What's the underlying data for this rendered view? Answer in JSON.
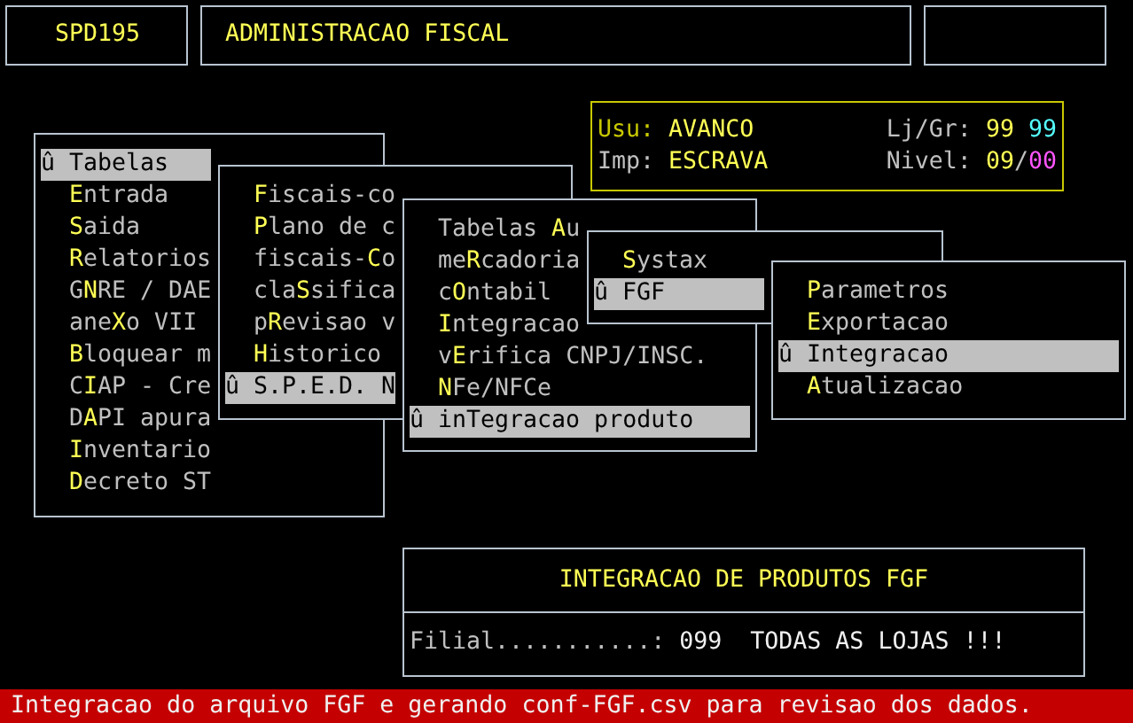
{
  "header": {
    "program_code": "SPD195",
    "title": "ADMINISTRACAO FISCAL"
  },
  "session": {
    "user_label": "Usu:",
    "user": "AVANCO",
    "store_label": "Lj/Gr:",
    "store": "99",
    "group": "99",
    "printer_label": "Imp:",
    "printer": "ESCRAVA",
    "level_label": "Nivel:",
    "level_user": "09",
    "level_sep": "/",
    "level_group": "00"
  },
  "menus": [
    {
      "items": [
        {
          "marker": "û",
          "label": "Tabelas",
          "selected": true
        },
        {
          "hotkey": "E",
          "after": "ntrada",
          "selected": false
        },
        {
          "hotkey": "S",
          "after": "aida",
          "selected": false
        },
        {
          "hotkey": "R",
          "after": "elatorios",
          "selected": false
        },
        {
          "before": "G",
          "hotkey": "N",
          "after": "RE / DAE",
          "selected": false
        },
        {
          "before": "ane",
          "hotkey": "X",
          "after": "o VII",
          "selected": false
        },
        {
          "hotkey": "B",
          "after": "loquear m",
          "selected": false
        },
        {
          "before": "C",
          "hotkey": "I",
          "after": "AP - Cre",
          "selected": false
        },
        {
          "before": "D",
          "hotkey": "A",
          "after": "PI apura",
          "selected": false
        },
        {
          "hotkey": "I",
          "after": "nventario",
          "selected": false
        },
        {
          "hotkey": "D",
          "after": "ecreto ST",
          "selected": false
        }
      ]
    },
    {
      "items": [
        {
          "hotkey": "F",
          "after": "iscais-co",
          "selected": false
        },
        {
          "hotkey": "P",
          "after": "lano de c",
          "selected": false
        },
        {
          "before": "fiscais-",
          "hotkey": "C",
          "after": "o",
          "selected": false
        },
        {
          "before": "cla",
          "hotkey": "S",
          "after": "sifica",
          "selected": false
        },
        {
          "before": "p",
          "hotkey": "R",
          "after": "evisao v",
          "selected": false
        },
        {
          "hotkey": "H",
          "after": "istorico",
          "selected": false
        },
        {
          "marker": "û",
          "label": "S.P.E.D. N",
          "selected": true
        }
      ]
    },
    {
      "items": [
        {
          "before": "Tabelas ",
          "hotkey": "A",
          "after": "u",
          "selected": false
        },
        {
          "before": "me",
          "hotkey": "R",
          "after": "cadoria",
          "selected": false
        },
        {
          "before": "c",
          "hotkey": "O",
          "after": "ntabil",
          "selected": false
        },
        {
          "hotkey": "I",
          "after": "ntegracao",
          "selected": false
        },
        {
          "before": "v",
          "hotkey": "E",
          "after": "rifica CNPJ/INSC.",
          "selected": false
        },
        {
          "hotkey": "N",
          "after": "Fe/NFCe",
          "selected": false
        },
        {
          "marker": "û",
          "label": "inTegracao produto",
          "selected": true
        }
      ]
    },
    {
      "items": [
        {
          "hotkey": "S",
          "after": "ystax",
          "selected": false
        },
        {
          "marker": "û",
          "label": "FGF",
          "selected": true
        }
      ]
    },
    {
      "items": [
        {
          "hotkey": "P",
          "after": "arametros",
          "selected": false
        },
        {
          "hotkey": "E",
          "after": "xportacao",
          "selected": false
        },
        {
          "marker": "û",
          "label": "Integracao",
          "selected": true
        },
        {
          "hotkey": "A",
          "after": "tualizacao",
          "selected": false
        }
      ]
    }
  ],
  "dialog": {
    "title": "INTEGRACAO DE PRODUTOS FGF",
    "field_label": "Filial...........:",
    "field_value": "099",
    "field_note": "TODAS AS LOJAS !!!"
  },
  "status_bar": "Integracao do arquivo FGF e gerando conf-FGF.csv para revisao dos dados."
}
